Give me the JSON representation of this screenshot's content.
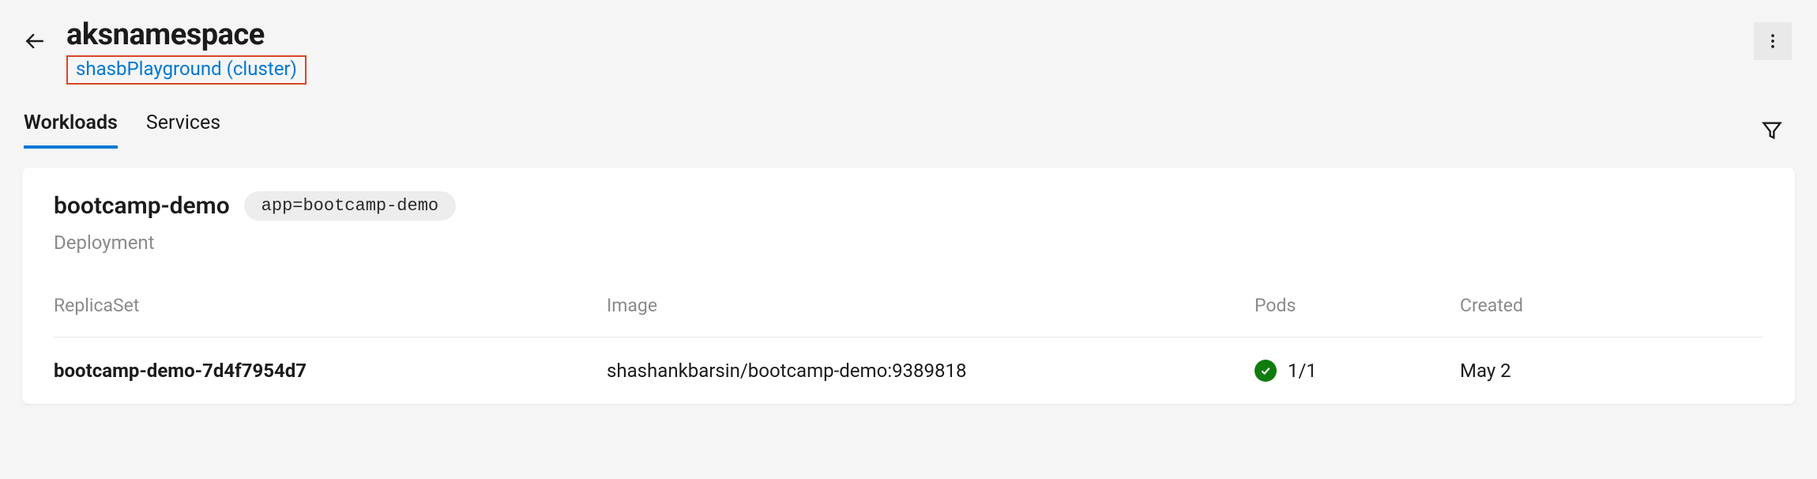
{
  "header": {
    "title": "aksnamespace",
    "cluster_link": "shasbPlayground (cluster)"
  },
  "tabs": {
    "workloads": "Workloads",
    "services": "Services"
  },
  "card": {
    "name": "bootcamp-demo",
    "label": "app=bootcamp-demo",
    "kind": "Deployment"
  },
  "columns": {
    "replicaset": "ReplicaSet",
    "image": "Image",
    "pods": "Pods",
    "created": "Created"
  },
  "rows": [
    {
      "name": "bootcamp-demo-7d4f7954d7",
      "image": "shashankbarsin/bootcamp-demo:9389818",
      "pods": "1/1",
      "created": "May 2",
      "status": "success"
    }
  ]
}
